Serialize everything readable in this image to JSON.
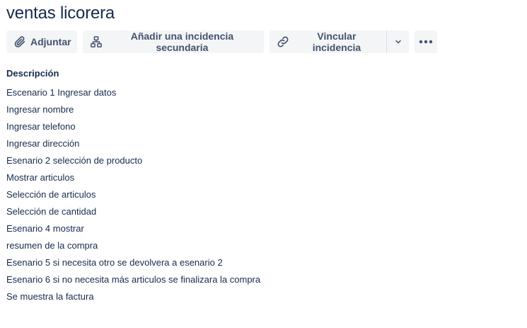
{
  "issue": {
    "title": "ventas licorera"
  },
  "toolbar": {
    "attach_label": "Adjuntar",
    "child_issue_label": "Añadir una incidencia secundaria",
    "link_issue_label": "Vincular incidencia"
  },
  "description": {
    "heading": "Descripción",
    "lines": [
      "Escenario 1 Ingresar datos",
      "Ingresar nombre",
      "Ingresar telefono",
      "Ingresar dirección",
      "Esenario 2 selección de producto",
      "Mostrar articulos",
      "Selección de articulos",
      "Selección de cantidad",
      "Esenario 4 mostrar",
      "resumen de la compra",
      "Esenario 5 si necesita otro se devolvera a esenario 2",
      "Esenario 6 si no necesita más articulos se finalizara la compra",
      "Se muestra la factura"
    ]
  },
  "icons": {
    "attach": "paperclip-icon",
    "child_issue": "hierarchy-icon",
    "link_issue": "link-icon",
    "caret": "chevron-down-icon",
    "more": "more-horizontal-icon"
  },
  "colors": {
    "text": "#172b4d",
    "button_text": "#42526e",
    "button_bg": "#f4f5f7"
  }
}
